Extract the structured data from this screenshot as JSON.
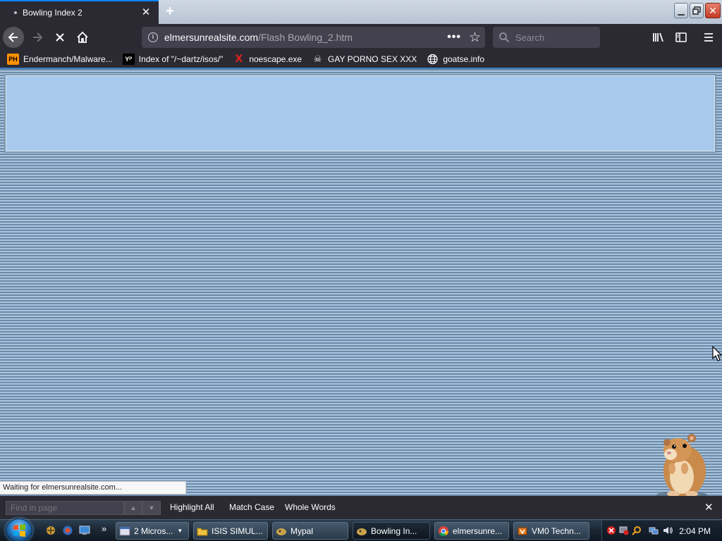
{
  "browser": {
    "tab_title": "Bowling Index 2",
    "new_tab_symbol": "+",
    "url_host": "elmersunrealsite.com",
    "url_path": "/Flash Bowling_2.htm",
    "search_placeholder": "Search",
    "page_actions": "•••"
  },
  "bookmarks": [
    {
      "label": "Endermanch/Malware...",
      "icon": "pornhub-favicon"
    },
    {
      "label": "Index of \"/~dartz/isos/\"",
      "icon": "yp-favicon"
    },
    {
      "label": "noescape.exe",
      "icon": "x-favicon"
    },
    {
      "label": "GAY PORNO SEX XXX",
      "icon": "skull-favicon"
    },
    {
      "label": "goatse.info",
      "icon": "globe-icon"
    }
  ],
  "status_text": "Waiting for elmersunrealsite.com...",
  "findbar": {
    "placeholder": "Find in page",
    "highlight_all": "Highlight All",
    "match_case": "Match Case",
    "whole_words": "Whole Words"
  },
  "taskbar": {
    "tasks": [
      {
        "label": "2 Micros...",
        "icon": "window-icon"
      },
      {
        "label": "ISIS SIMUL...",
        "icon": "folder-icon"
      },
      {
        "label": "Mypal",
        "icon": "mypal-icon"
      },
      {
        "label": "Bowling In...",
        "icon": "mypal-icon",
        "active": true
      },
      {
        "label": "elmersunre...",
        "icon": "chrome-icon"
      },
      {
        "label": "VM0 Techn...",
        "icon": "vm-icon"
      }
    ],
    "overflow_symbol": "»",
    "clock": "2:04 PM"
  },
  "colors": {
    "accent": "#0a84ff",
    "toolbar": "#2b2a33",
    "field": "#42414d",
    "banner": "#a7c9ec",
    "stripe_light": "#a8c4df",
    "stripe_dark": "#6d8aa7"
  }
}
